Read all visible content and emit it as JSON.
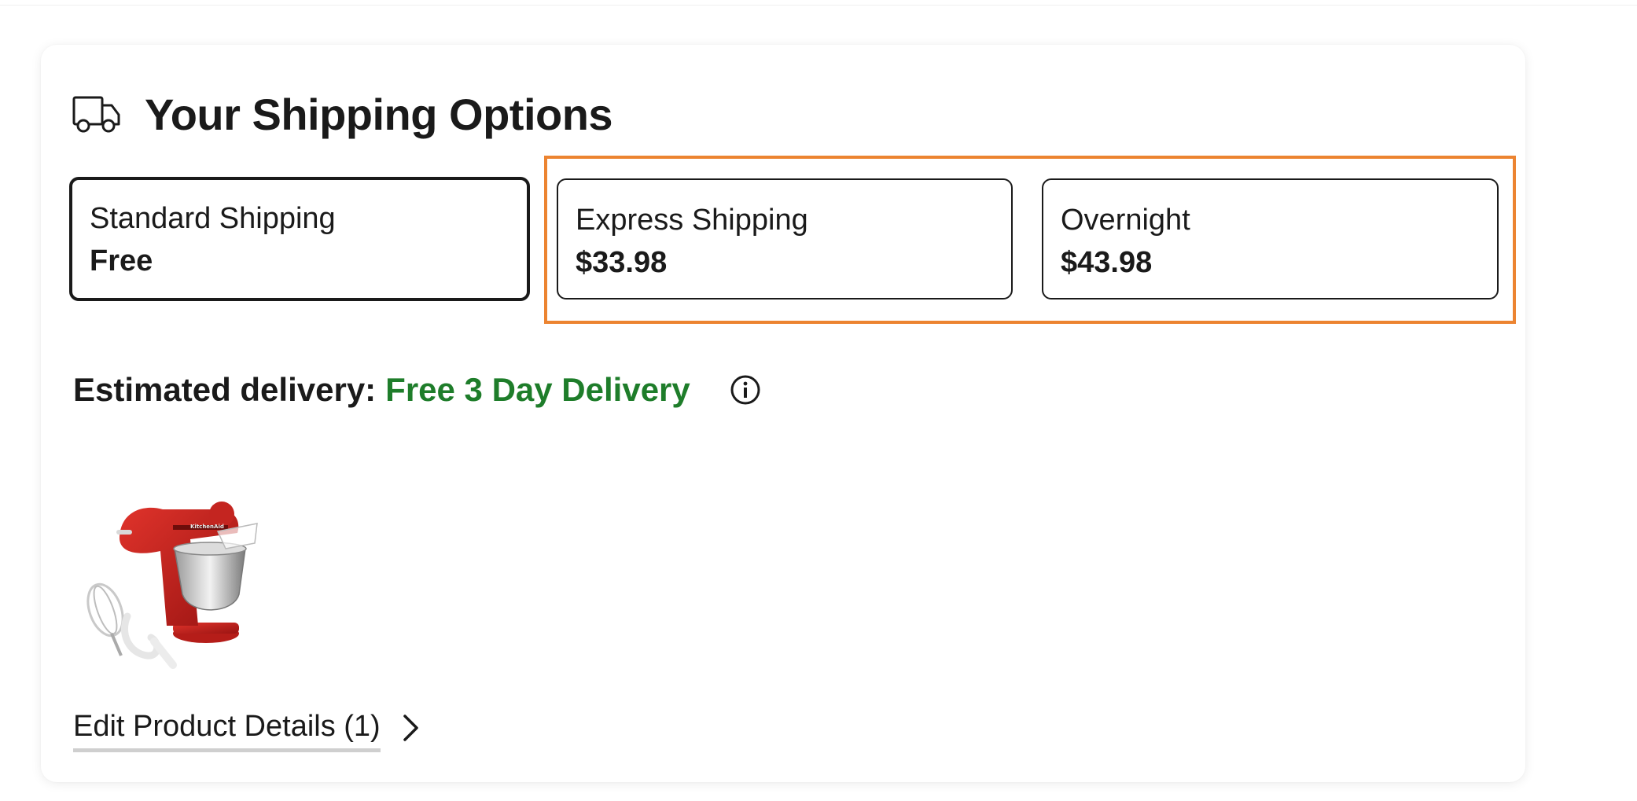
{
  "header": {
    "icon": "truck-icon",
    "title": "Your Shipping Options"
  },
  "shipping_options": [
    {
      "name": "Standard Shipping",
      "price": "Free",
      "selected": true
    },
    {
      "name": "Express Shipping",
      "price": "$33.98",
      "selected": false
    },
    {
      "name": "Overnight",
      "price": "$43.98",
      "selected": false
    }
  ],
  "delivery": {
    "label": "Estimated delivery:",
    "value": "Free 3 Day Delivery",
    "value_color": "#1e7d2a",
    "info_icon": "info-icon"
  },
  "product": {
    "image": "stand-mixer-image"
  },
  "edit_link": {
    "label": "Edit Product Details (1)",
    "icon": "chevron-right-icon"
  },
  "colors": {
    "highlight": "#ec8431",
    "text": "#1a1a1a",
    "accent_green": "#1e7d2a"
  }
}
